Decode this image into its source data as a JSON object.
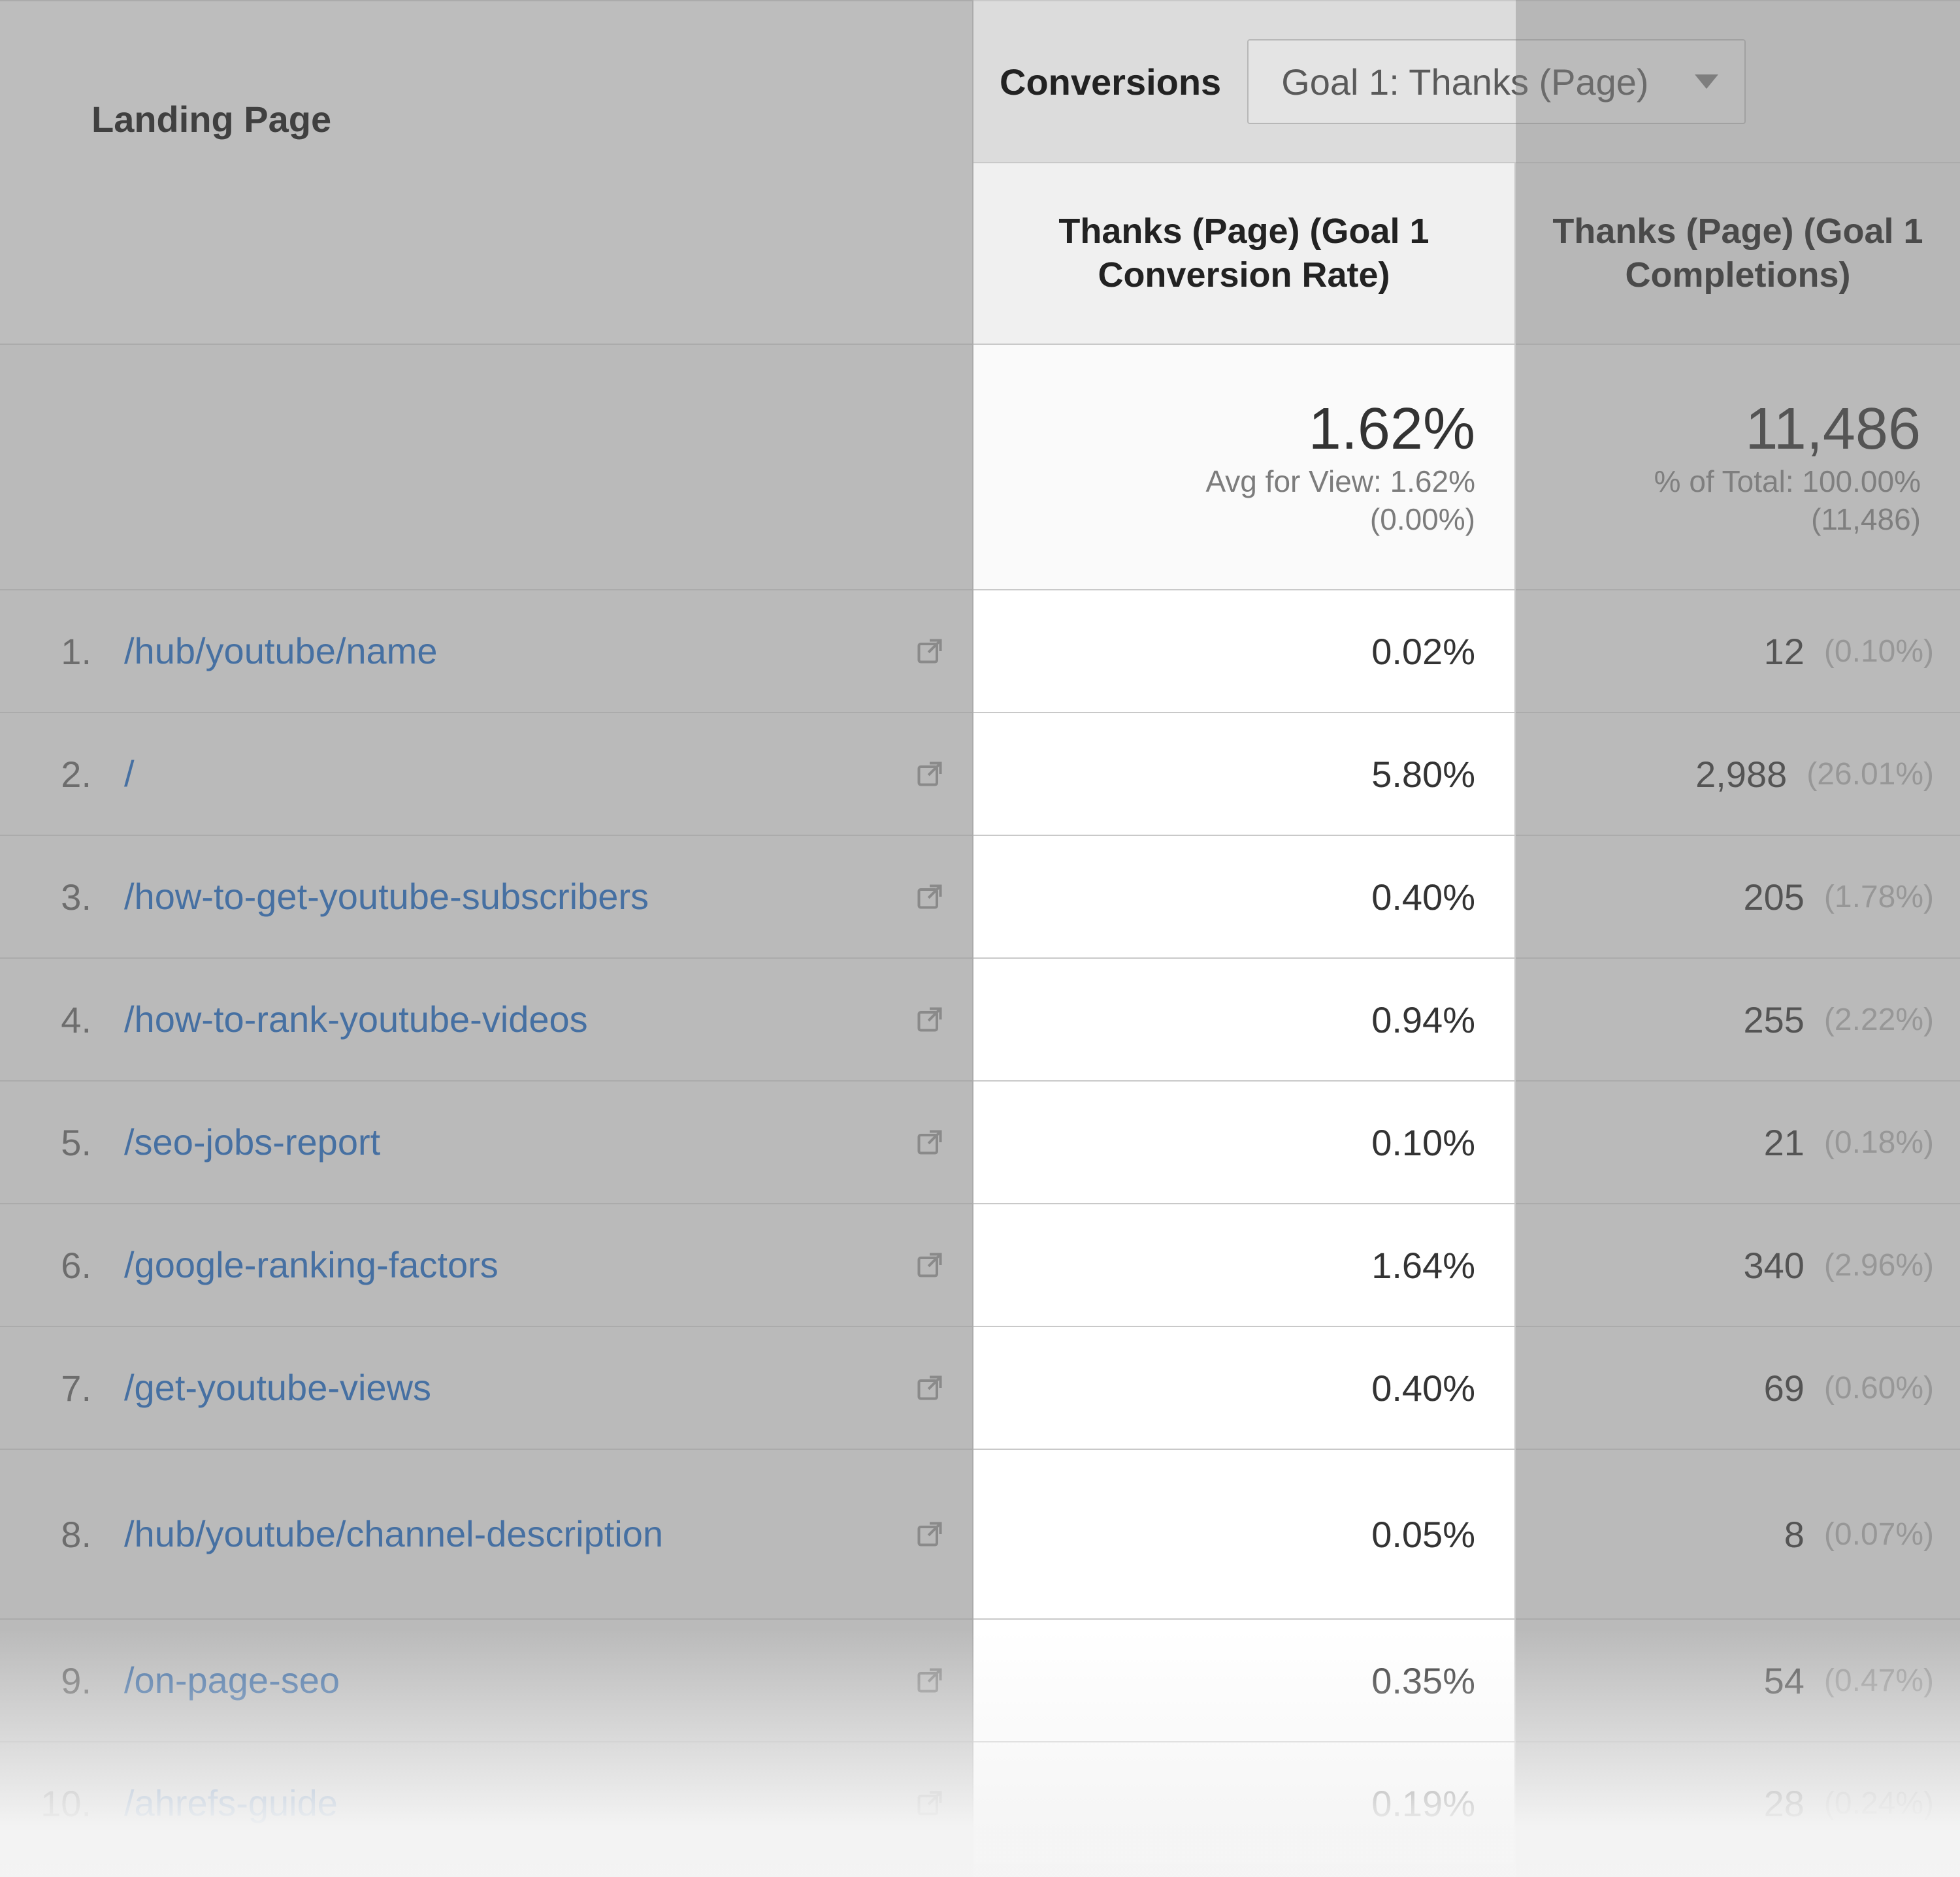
{
  "header": {
    "dimension_label": "Landing Page",
    "conversions_label": "Conversions",
    "goal_selector": "Goal 1: Thanks (Page)",
    "col_rate": "Thanks (Page) (Goal 1 Conversion Rate)",
    "col_completions": "Thanks (Page) (Goal 1 Completions)"
  },
  "summary": {
    "rate_value": "1.62%",
    "rate_sub1": "Avg for View: 1.62%",
    "rate_sub2": "(0.00%)",
    "compl_value": "11,486",
    "compl_sub1": "% of Total: 100.00%",
    "compl_sub2": "(11,486)"
  },
  "rows": [
    {
      "idx": "1.",
      "page": "/hub/youtube/name",
      "rate": "0.02%",
      "compl": "12",
      "pct": "(0.10%)"
    },
    {
      "idx": "2.",
      "page": "/",
      "rate": "5.80%",
      "compl": "2,988",
      "pct": "(26.01%)"
    },
    {
      "idx": "3.",
      "page": "/how-to-get-youtube-subscribers",
      "rate": "0.40%",
      "compl": "205",
      "pct": "(1.78%)"
    },
    {
      "idx": "4.",
      "page": "/how-to-rank-youtube-videos",
      "rate": "0.94%",
      "compl": "255",
      "pct": "(2.22%)"
    },
    {
      "idx": "5.",
      "page": "/seo-jobs-report",
      "rate": "0.10%",
      "compl": "21",
      "pct": "(0.18%)"
    },
    {
      "idx": "6.",
      "page": "/google-ranking-factors",
      "rate": "1.64%",
      "compl": "340",
      "pct": "(2.96%)"
    },
    {
      "idx": "7.",
      "page": "/get-youtube-views",
      "rate": "0.40%",
      "compl": "69",
      "pct": "(0.60%)"
    },
    {
      "idx": "8.",
      "page": "/hub/youtube/channel-description",
      "rate": "0.05%",
      "compl": "8",
      "pct": "(0.07%)"
    },
    {
      "idx": "9.",
      "page": "/on-page-seo",
      "rate": "0.35%",
      "compl": "54",
      "pct": "(0.47%)"
    },
    {
      "idx": "10.",
      "page": "/ahrefs-guide",
      "rate": "0.19%",
      "compl": "28",
      "pct": "(0.24%)"
    }
  ]
}
